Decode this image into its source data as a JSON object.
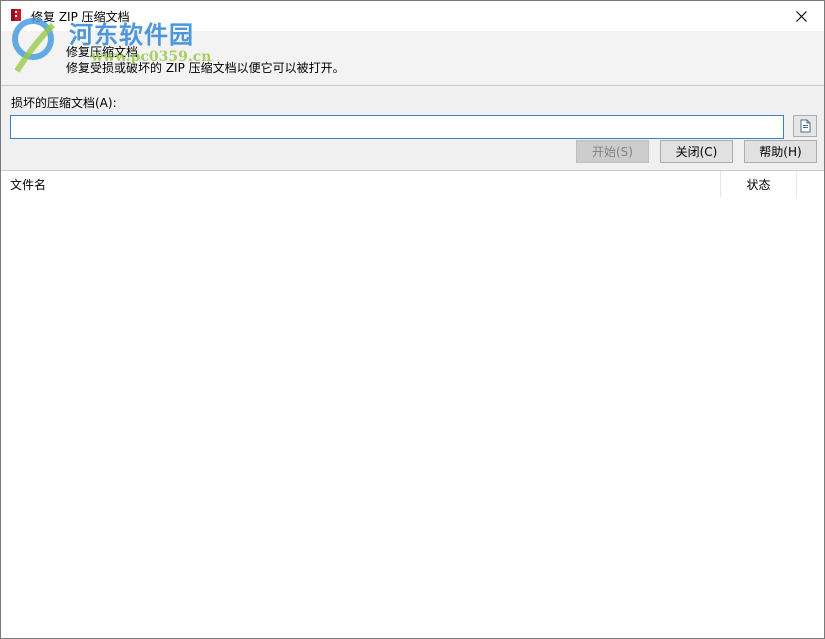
{
  "window": {
    "title": "修复 ZIP 压缩文档"
  },
  "watermark": {
    "brand": "河东软件园",
    "url": "www.pc0359.cn"
  },
  "header": {
    "title": "修复压缩文档",
    "description": "修复受损或破坏的 ZIP 压缩文档以便它可以被打开。"
  },
  "form": {
    "archive_label": "损坏的压缩文档(A):",
    "archive_value": "",
    "buttons": {
      "start": "开始(S)",
      "close": "关闭(C)",
      "help": "帮助(H)"
    }
  },
  "list": {
    "columns": [
      "文件名",
      "状态",
      ""
    ]
  },
  "icons": {
    "app": "zip-repair-icon",
    "close": "close-icon",
    "browse": "browse-file-icon"
  },
  "colors": {
    "input_focus_border": "#3a7fd0",
    "disabled_button": "#cccccc",
    "watermark_blue": "#2f86d8",
    "watermark_green": "#9ac94a"
  }
}
